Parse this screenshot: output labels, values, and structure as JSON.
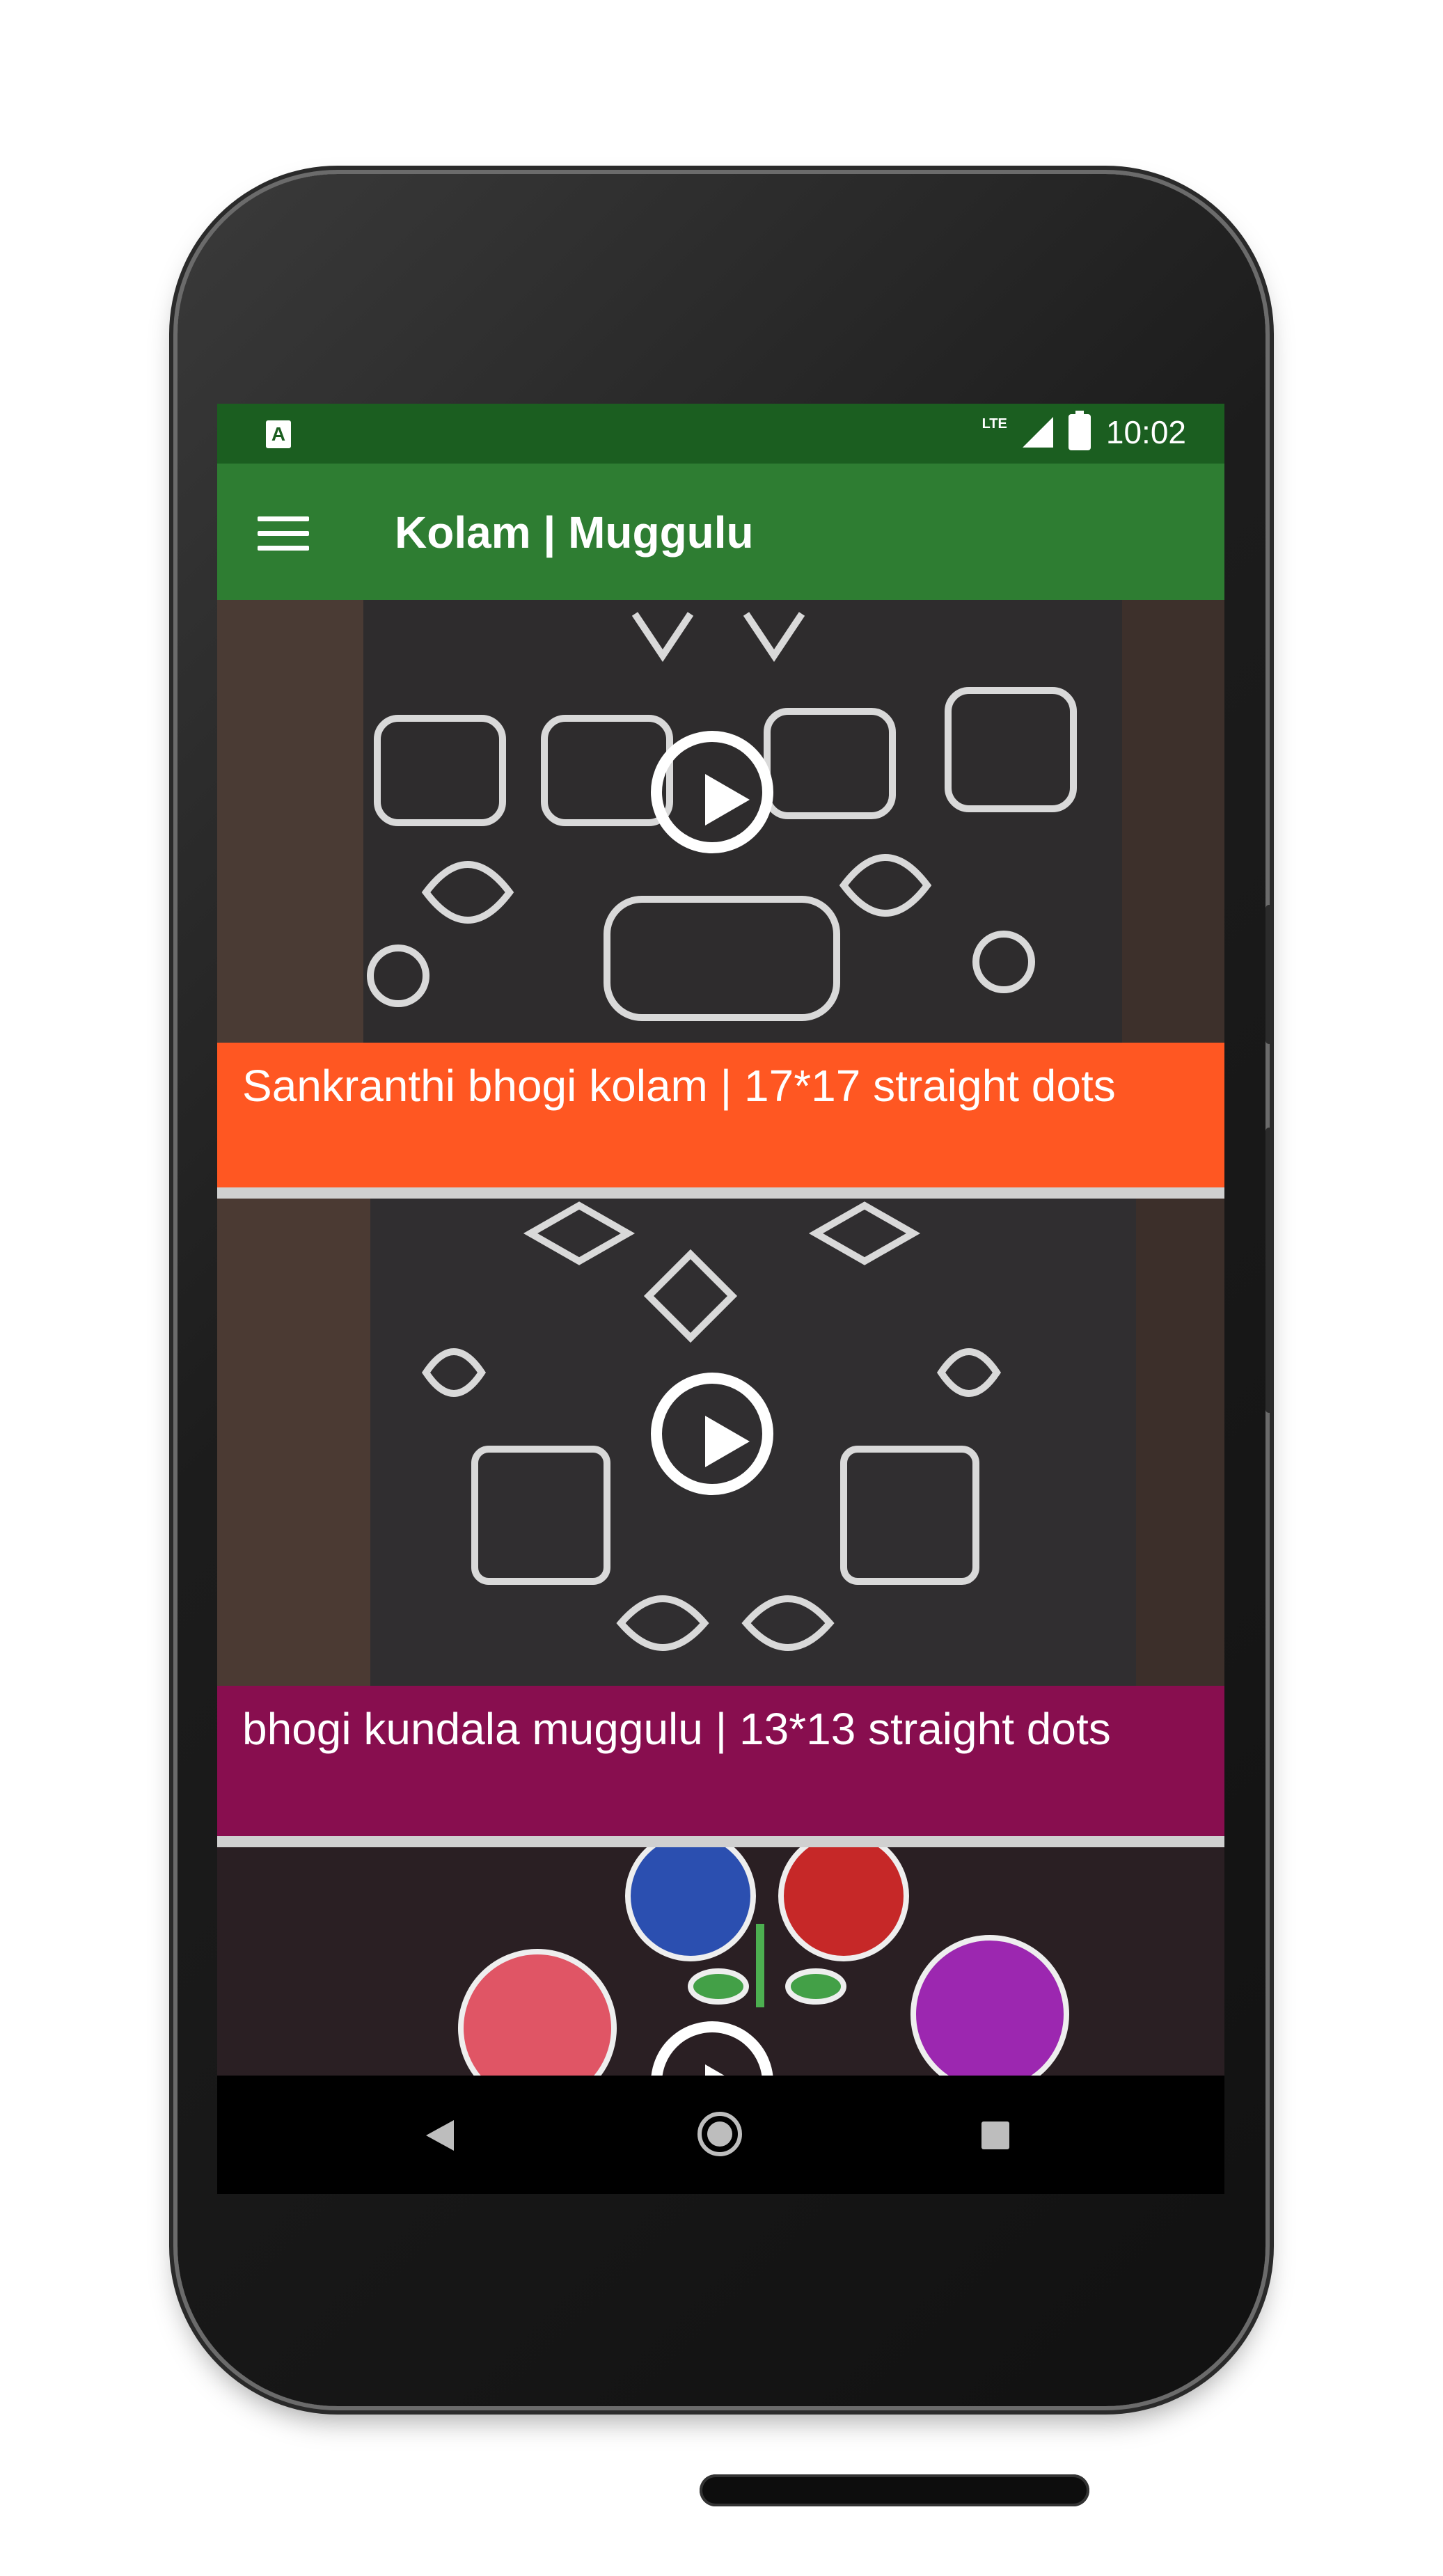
{
  "status_bar": {
    "app_indicator": "A",
    "network": "LTE",
    "time": "10:02"
  },
  "toolbar": {
    "title": "Kolam | Muggulu",
    "menu_icon": "hamburger-menu-icon"
  },
  "videos": [
    {
      "title": "Sankranthi bhogi kolam | 17*17 straight dots",
      "caption_color": "#ff5722"
    },
    {
      "title": "bhogi kundala muggulu | 13*13 straight dots",
      "caption_color": "#880e4f"
    },
    {
      "title": "",
      "caption_color": ""
    }
  ],
  "nav_bar": {
    "back_icon": "back-icon",
    "home_icon": "home-icon",
    "recents_icon": "recents-icon"
  },
  "colors": {
    "status_bar": "#1b5e20",
    "toolbar": "#2e7d32"
  }
}
